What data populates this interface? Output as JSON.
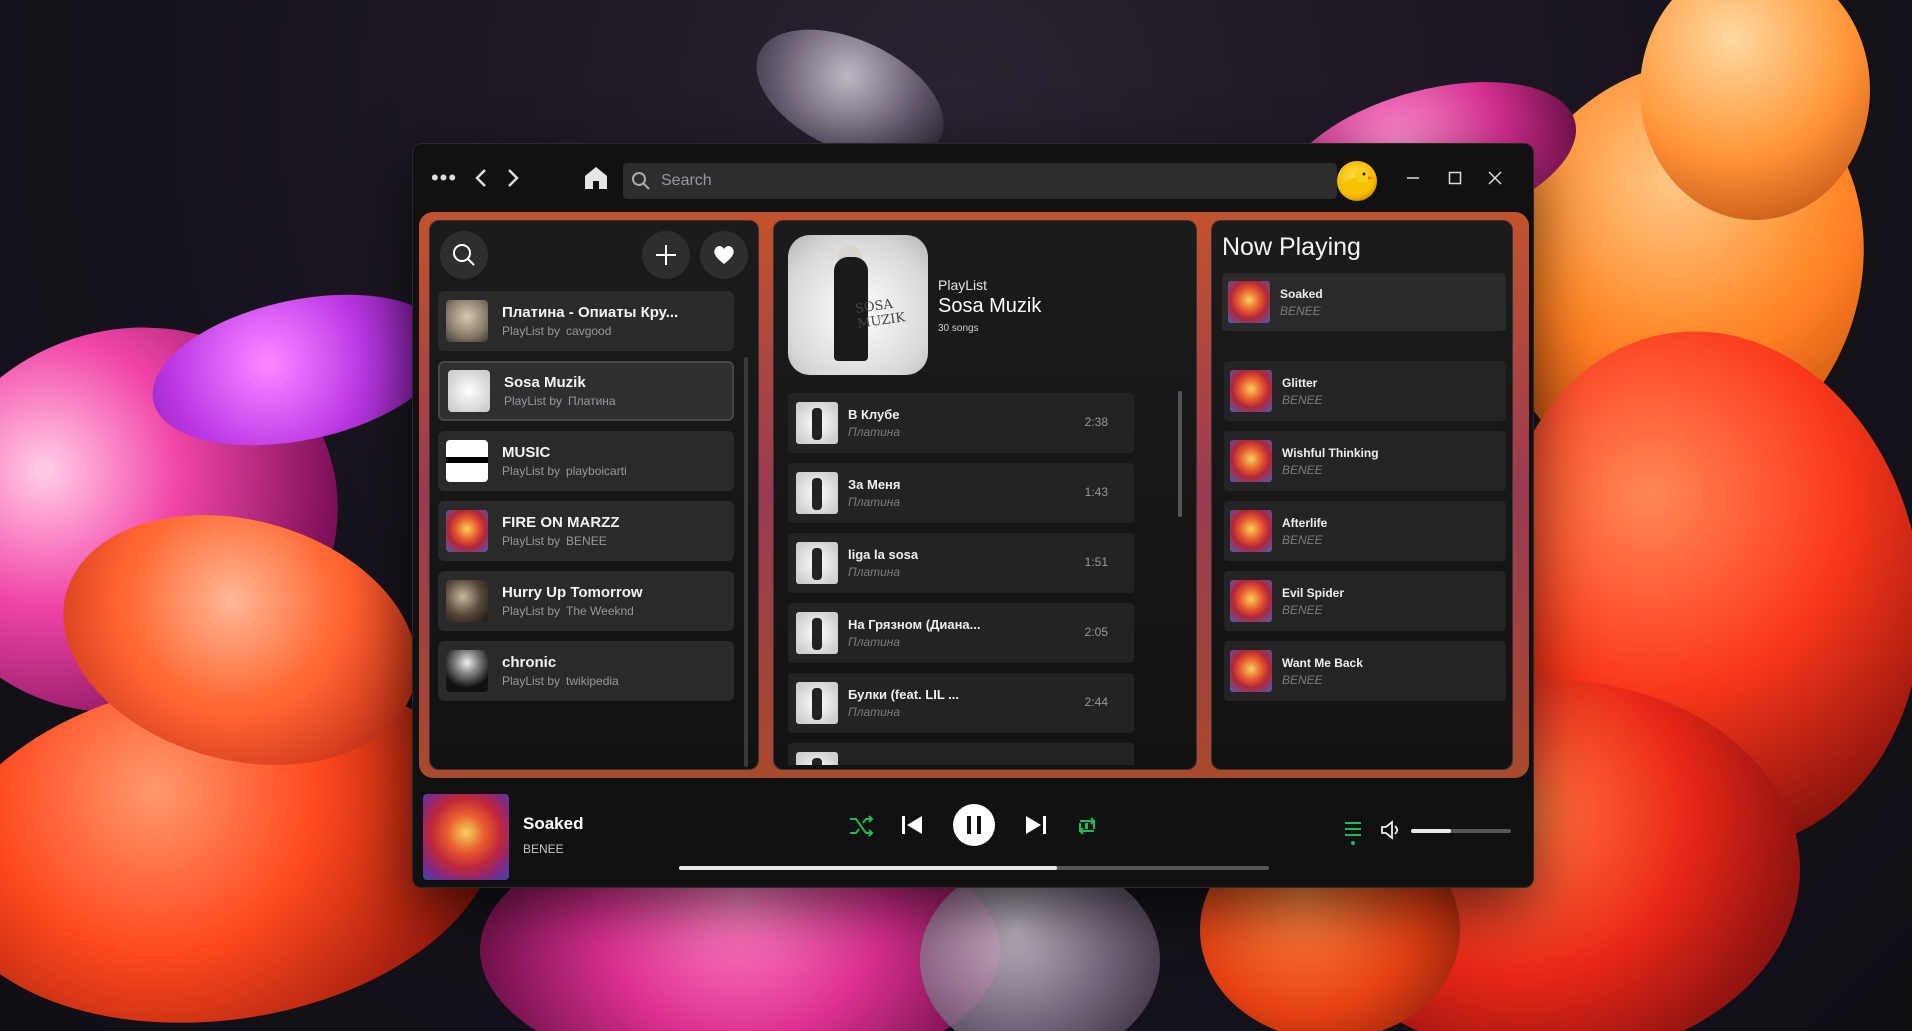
{
  "titlebar": {
    "search_placeholder": "Search"
  },
  "library": {
    "playlists": [
      {
        "title": "Платина - Опиаты Кру...",
        "by_label": "PlayList by",
        "owner": "cavgood",
        "cover": "#6a6a5a"
      },
      {
        "title": "Sosa Muzik",
        "by_label": "PlayList by",
        "owner": "Платина",
        "cover": "#d8d8d8",
        "active": true
      },
      {
        "title": "MUSIC",
        "by_label": "PlayList by",
        "owner": "playboicarti",
        "cover": "#ffffff"
      },
      {
        "title": "FIRE ON MARZZ",
        "by_label": "PlayList by",
        "owner": "BENEE",
        "cover": "#e05a2a"
      },
      {
        "title": "Hurry Up Tomorrow",
        "by_label": "PlayList by",
        "owner": "The Weeknd",
        "cover": "#3a2a20"
      },
      {
        "title": "chronic",
        "by_label": "PlayList by",
        "owner": "twikipedia",
        "cover": "#1a1a1a"
      }
    ]
  },
  "playlist_view": {
    "kind": "PlayList",
    "name": "Sosa Muzik",
    "count": "30 songs",
    "cover_text": "SOSA MUZIK",
    "tracks": [
      {
        "title": "В Клубе",
        "artist": "Платина",
        "duration": "2:38"
      },
      {
        "title": "За Меня",
        "artist": "Платина",
        "duration": "1:43"
      },
      {
        "title": "liga la sosa",
        "artist": "Платина",
        "duration": "1:51"
      },
      {
        "title": "На Грязном (Диана...",
        "artist": "Платина",
        "duration": "2:05"
      },
      {
        "title": "Булки (feat. LIL ...",
        "artist": "Платина",
        "duration": "2:44"
      }
    ]
  },
  "now_playing": {
    "heading": "Now Playing",
    "current": {
      "song": "Soaked",
      "artist": "BENEE"
    },
    "queue": [
      {
        "song": "Glitter",
        "artist": "BENEE"
      },
      {
        "song": "Wishful Thinking",
        "artist": "BENEE"
      },
      {
        "song": "Afterlife",
        "artist": "BENEE"
      },
      {
        "song": "Evil Spider",
        "artist": "BENEE"
      },
      {
        "song": "Want Me Back",
        "artist": "BENEE"
      }
    ]
  },
  "player": {
    "song": "Soaked",
    "artist": "BENEE",
    "progress": 0.64,
    "volume": 0.4,
    "accent_color": "#1db954"
  }
}
